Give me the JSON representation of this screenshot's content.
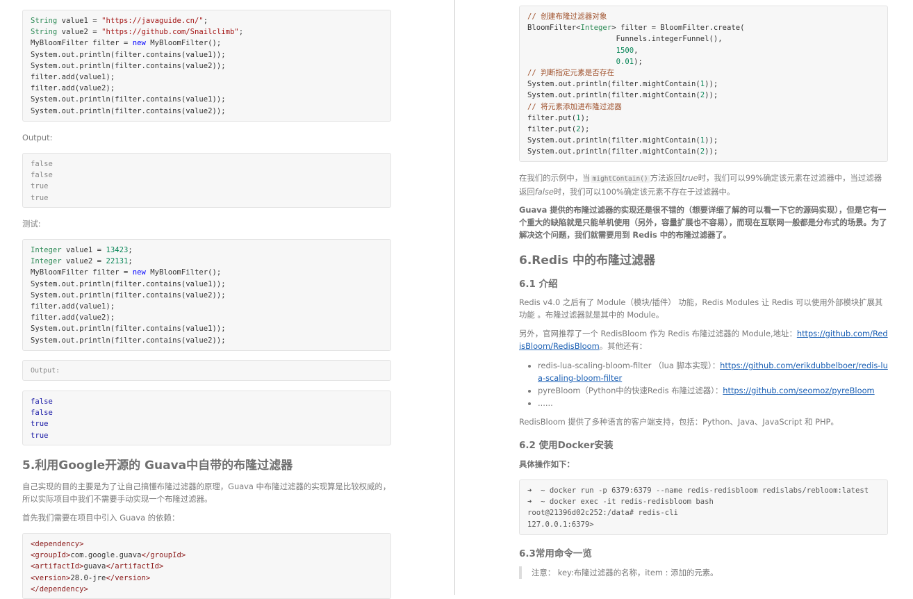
{
  "left": {
    "code1": [
      "String value1 = \"https://javaguide.cn/\";",
      "String value2 = \"https://github.com/Snailclimb\";",
      "MyBloomFilter filter = new MyBloomFilter();",
      "System.out.println(filter.contains(value1));",
      "System.out.println(filter.contains(value2));",
      "filter.add(value1);",
      "filter.add(value2);",
      "System.out.println(filter.contains(value1));",
      "System.out.println(filter.contains(value2));"
    ],
    "output_label": "Output:",
    "output1": [
      "false",
      "false",
      "true",
      "true"
    ],
    "test_label": "测试:",
    "code2": [
      "Integer value1 = 13423;",
      "Integer value2 = 22131;",
      "MyBloomFilter filter = new MyBloomFilter();",
      "System.out.println(filter.contains(value1));",
      "System.out.println(filter.contains(value2));",
      "filter.add(value1);",
      "filter.add(value2);",
      "System.out.println(filter.contains(value1));",
      "System.out.println(filter.contains(value2));"
    ],
    "output_box_label": "Output:",
    "output2": [
      "false",
      "false",
      "true",
      "true"
    ],
    "heading5": "5.利用Google开源的 Guava中自带的布隆过滤器",
    "para1": "自己实现的目的主要是为了让自己搞懂布隆过滤器的原理，Guava 中布隆过滤器的实现算是比较权威的，所以实际项目中我们不需要手动实现一个布隆过滤器。",
    "para2": "首先我们需要在项目中引入 Guava 的依赖：",
    "xml": [
      "<dependency>",
      "<groupId>com.google.guava</groupId>",
      "<artifactId>guava</artifactId>",
      "<version>28.0-jre</version>",
      "</dependency>"
    ]
  },
  "right": {
    "code_guava": [
      "// 创建布隆过滤器对象",
      "BloomFilter<Integer> filter = BloomFilter.create(",
      "                    Funnels.integerFunnel(),",
      "                    1500,",
      "                    0.01);",
      "// 判断指定元素是否存在",
      "System.out.println(filter.mightContain(1));",
      "System.out.println(filter.mightContain(2));",
      "// 将元素添加进布隆过滤器",
      "filter.put(1);",
      "filter.put(2);",
      "System.out.println(filter.mightContain(1));",
      "System.out.println(filter.mightContain(2));"
    ],
    "para_example_a": "在我们的示例中，当",
    "para_example_code": "mightContain()",
    "para_example_b": "方法返回",
    "para_example_true": "true",
    "para_example_c": "时，我们可以99%确定该元素在过滤器中，当过滤器返回",
    "para_example_false": "false",
    "para_example_d": "时，我们可以100%确定该元素不存在于过滤器中。",
    "para_bold": "Guava 提供的布隆过滤器的实现还是很不错的（想要详细了解的可以看一下它的源码实现），但是它有一个重大的缺陷就是只能单机使用（另外，容量扩展也不容易），而现在互联网一般都是分布式的场景。为了解决这个问题，我们就需要用到 Redis 中的布隆过滤器了。",
    "heading6": "6.Redis 中的布隆过滤器",
    "heading61": "6.1 介绍",
    "para_redis": "Redis v4.0 之后有了 Module（模块/插件） 功能，Redis Modules 让 Redis 可以使用外部模块扩展其功能 。布隆过滤器就是其中的 Module。",
    "para_official_a": "另外，官网推荐了一个 RedisBloom  作为 Redis 布隆过滤器的 Module,地址：",
    "para_official_link": "https://github.com/RedisBloom/RedisBloom",
    "para_official_b": "。其他还有：",
    "list": [
      {
        "text": "redis-lua-scaling-bloom-filter （lua 脚本实现）：",
        "link": "https://github.com/erikdubbelboer/redis-lua-scaling-bloom-filter"
      },
      {
        "text": "pyreBloom（Python中的快速Redis 布隆过滤器）：",
        "link": "https://github.com/seomoz/pyreBloom"
      },
      {
        "text": "......",
        "link": ""
      }
    ],
    "para_clients": "RedisBloom 提供了多种语言的客户端支持，包括：Python、Java、JavaScript 和 PHP。",
    "heading62": "6.2 使用Docker安装",
    "steps_label": "具体操作如下：",
    "shell": [
      "➜  ~ docker run -p 6379:6379 --name redis-redisbloom redislabs/rebloom:latest",
      "➜  ~ docker exec -it redis-redisbloom bash",
      "root@21396d02c252:/data# redis-cli",
      "127.0.0.1:6379>"
    ],
    "heading63": "6.3常用命令一览",
    "note": "注意： key:布隆过滤器的名称，item : 添加的元素。"
  }
}
